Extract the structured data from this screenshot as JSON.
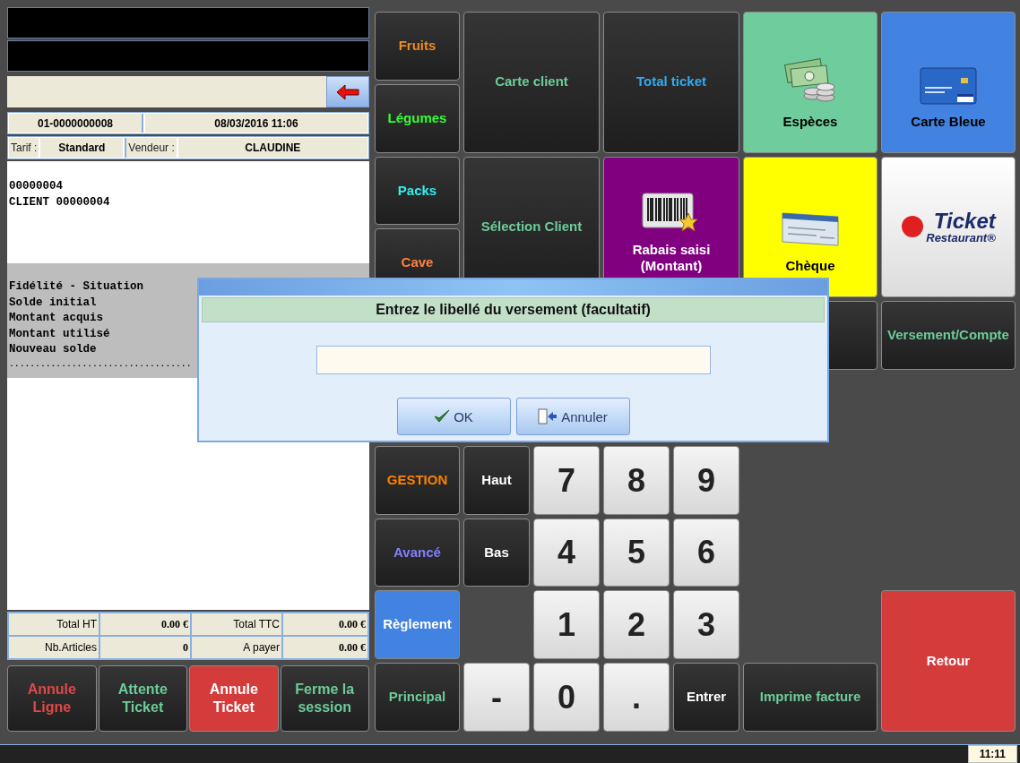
{
  "ticket_info": {
    "number": "01-0000000008",
    "datetime": "08/03/2016 11:06",
    "tariff_label": "Tarif :",
    "tariff": "Standard",
    "seller_label": "Vendeur :",
    "seller": "CLAUDINE"
  },
  "ticket_lines": [
    "00000004",
    "CLIENT 00000004"
  ],
  "loyalty_lines": [
    "Fidélité - Situation",
    "Solde initial",
    "Montant acquis",
    "Montant utilisé",
    "Nouveau solde"
  ],
  "loyalty_rule": "...................................",
  "totals": [
    {
      "label": "Total HT",
      "value": "0.00 €"
    },
    {
      "label": "Total TTC",
      "value": "0.00 €"
    },
    {
      "label": "Nb.Articles",
      "value": "0"
    },
    {
      "label": "A payer",
      "value": "0.00 €"
    }
  ],
  "ticket_buttons": [
    {
      "label": "Annule Ligne",
      "kind": "dark",
      "color": "#e04848"
    },
    {
      "label": "Attente Ticket",
      "kind": "dark",
      "color": "#6dcc99"
    },
    {
      "label": "Annule Ticket",
      "kind": "alert",
      "color": "#ffffff"
    },
    {
      "label": "Ferme la session",
      "kind": "dark",
      "color": "#6dcc99"
    }
  ],
  "keys": [
    {
      "label": "Fruits",
      "kind": "dark",
      "color": "#f08a24"
    },
    {
      "label": "Légumes",
      "kind": "dark",
      "color": "#33ff33"
    },
    {
      "label": "Carte client",
      "kind": "dark",
      "color": "#6dcc99"
    },
    {
      "label": "Total ticket",
      "kind": "dark",
      "color": "#33aaee"
    },
    {
      "label": "Espèces",
      "kind": "cash",
      "color": "#000000"
    },
    {
      "label": "Carte Bleue",
      "kind": "card",
      "color": "#000000"
    },
    {
      "label": "Packs",
      "kind": "dark",
      "color": "#33eeee"
    },
    {
      "label": "Cave",
      "kind": "dark",
      "color": "#ff8040"
    },
    {
      "label": "Sélection Client",
      "kind": "dark",
      "color": "#6dcc99"
    },
    {
      "label": "Rabais saisi (Montant)",
      "kind": "barcode",
      "color": "#ffffff"
    },
    {
      "label": "Chèque",
      "kind": "cheque",
      "color": "#000000"
    },
    {
      "label": "Ticket",
      "sublabel": "Restaurant®",
      "kind": "logo",
      "color": "#1a2a6a"
    },
    {
      "kind": "dark"
    },
    {
      "label": "Versement/Compte",
      "kind": "dark",
      "color": "#6dcc99"
    },
    {
      "label": "GESTION",
      "kind": "dark",
      "color": "#ff8000"
    },
    {
      "label": "Haut",
      "kind": "dark",
      "color": "#ffffff"
    },
    {
      "label": "7",
      "kind": "digit"
    },
    {
      "label": "8",
      "kind": "digit"
    },
    {
      "label": "9",
      "kind": "digit"
    },
    {
      "label": "Avancé",
      "kind": "dark",
      "color": "#8080ff"
    },
    {
      "label": "Bas",
      "kind": "dark",
      "color": "#ffffff"
    },
    {
      "label": "4",
      "kind": "digit"
    },
    {
      "label": "5",
      "kind": "digit"
    },
    {
      "label": "6",
      "kind": "digit"
    },
    {
      "label": "Règlement",
      "kind": "pay",
      "color": "#ffffff"
    },
    {
      "label": "1",
      "kind": "digit"
    },
    {
      "label": "2",
      "kind": "digit"
    },
    {
      "label": "3",
      "kind": "digit"
    },
    {
      "label": "Retour",
      "kind": "alert",
      "color": "#ffffff"
    },
    {
      "label": "Principal",
      "kind": "dark",
      "color": "#6dcc99"
    },
    {
      "label": "-",
      "kind": "digit"
    },
    {
      "label": "0",
      "kind": "digit"
    },
    {
      "label": ".",
      "kind": "digit"
    },
    {
      "label": "Entrer",
      "kind": "dark",
      "color": "#ffffff"
    },
    {
      "label": "Imprime facture",
      "kind": "dark",
      "color": "#6dcc99"
    }
  ],
  "dialog": {
    "title": "Entrez le libellé du versement (facultatif)",
    "buttons": [
      {
        "label": "OK",
        "kind": "ok"
      },
      {
        "label": "Annuler",
        "kind": "cancel"
      }
    ]
  },
  "status_bar": {
    "clock": "11:11"
  }
}
